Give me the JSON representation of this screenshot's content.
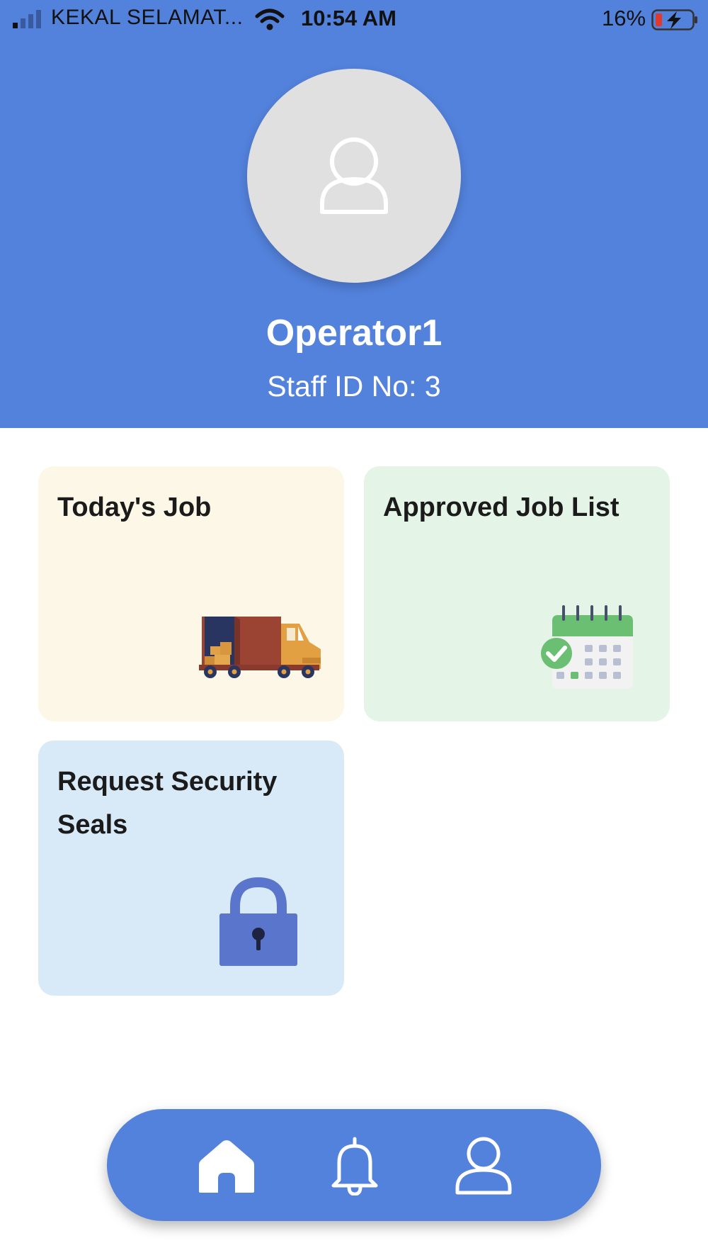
{
  "status_bar": {
    "carrier": "KEKAL SELAMAT...",
    "time": "10:54 AM",
    "battery_percent": "16%",
    "icons": [
      "signal-icon",
      "wifi-icon",
      "battery-charging-icon"
    ]
  },
  "profile": {
    "avatar_icon": "user-icon",
    "name": "Operator1",
    "staff_id_label": "Staff ID No:",
    "staff_id_value": "3"
  },
  "cards": [
    {
      "title": "Today's Job",
      "icon": "delivery-truck-icon",
      "background": "#fdf7e7"
    },
    {
      "title": "Approved Job List",
      "icon": "calendar-check-icon",
      "background": "#e4f4e6"
    },
    {
      "title": "Request Security Seals",
      "icon": "lock-icon",
      "background": "#d8e9f8"
    }
  ],
  "bottom_nav": {
    "items": [
      {
        "icon": "home-icon",
        "active": true
      },
      {
        "icon": "bell-icon",
        "active": false
      },
      {
        "icon": "profile-icon",
        "active": false
      }
    ]
  },
  "colors": {
    "primary": "#5382dc",
    "avatar_bg": "#e0e0e0",
    "lock": "#5a75cc",
    "calendar_green": "#6bbf72"
  }
}
